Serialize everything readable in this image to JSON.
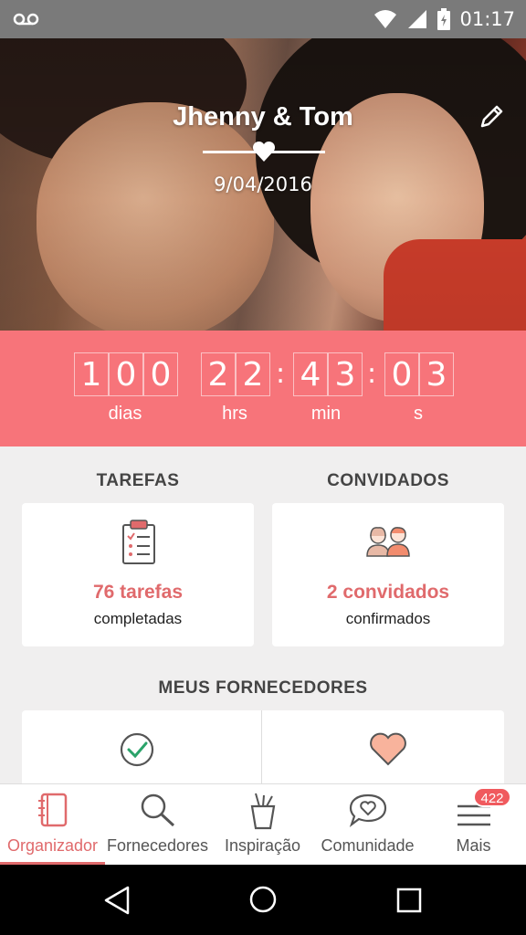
{
  "status_bar": {
    "time": "01:17",
    "icons": [
      "voicemail-icon",
      "wifi-icon",
      "signal-icon",
      "battery-icon"
    ]
  },
  "hero": {
    "names": "Jhenny & Tom",
    "date": "9/04/2016",
    "edit_icon": "pencil-icon"
  },
  "countdown": {
    "days": [
      "1",
      "0",
      "0"
    ],
    "hours": [
      "2",
      "2"
    ],
    "minutes": [
      "4",
      "3"
    ],
    "seconds": [
      "0",
      "3"
    ],
    "labels": {
      "days": "dias",
      "hours": "hrs",
      "minutes": "min",
      "seconds": "s"
    }
  },
  "tasks": {
    "title": "TAREFAS",
    "count": "76 tarefas",
    "status": "completadas",
    "icon": "clipboard-icon"
  },
  "guests": {
    "title": "CONVIDADOS",
    "count": "2 convidados",
    "status": "confirmados",
    "icon": "couple-icon"
  },
  "suppliers": {
    "title": "MEUS FORNECEDORES",
    "icons": [
      "check-circle-icon",
      "heart-icon"
    ]
  },
  "bottom_nav": {
    "items": [
      {
        "label": "Organizador",
        "icon": "notebook-icon",
        "active": true
      },
      {
        "label": "Fornecedores",
        "icon": "search-icon"
      },
      {
        "label": "Inspiração",
        "icon": "brush-cup-icon"
      },
      {
        "label": "Comunidade",
        "icon": "chat-heart-icon"
      },
      {
        "label": "Mais",
        "icon": "menu-icon"
      }
    ],
    "badge": "422"
  },
  "colors": {
    "accent": "#f7747a",
    "accent_text": "#e06a6c",
    "background": "#f0efef",
    "status_bar": "#7a7a7a"
  }
}
